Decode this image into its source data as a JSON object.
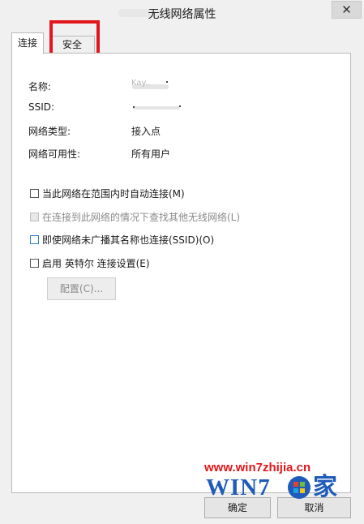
{
  "window": {
    "title": "无线网络属性",
    "close_label": "✕"
  },
  "tabs": [
    {
      "label": "连接",
      "selected": true
    },
    {
      "label": "安全",
      "selected": false
    }
  ],
  "info": [
    {
      "label": "名称:",
      "value": "Kay.."
    },
    {
      "label": "SSID:",
      "value": ""
    },
    {
      "label": "网络类型:",
      "value": "接入点"
    },
    {
      "label": "网络可用性:",
      "value": "所有用户"
    }
  ],
  "options": [
    {
      "label": "当此网络在范围内时自动连接(M)",
      "checked": false,
      "enabled": true
    },
    {
      "label": "在连接到此网络的情况下查找其他无线网络(L)",
      "checked": false,
      "enabled": false
    },
    {
      "label": "即使网络未广播其名称也连接(SSID)(O)",
      "checked": false,
      "enabled": true
    },
    {
      "label": "启用 英特尔 连接设置(E)",
      "checked": false,
      "enabled": true
    }
  ],
  "config_button": "配置(C)...",
  "buttons": {
    "ok": "确定",
    "cancel": "取消"
  },
  "watermark": {
    "url": "www.win7zhijia.cn",
    "logo_text": "WIN7",
    "logo_suffix": "家"
  },
  "colors": {
    "highlight": "#e3151d",
    "watermark_red": "#e0161c",
    "watermark_blue": "#1f5bb8"
  }
}
